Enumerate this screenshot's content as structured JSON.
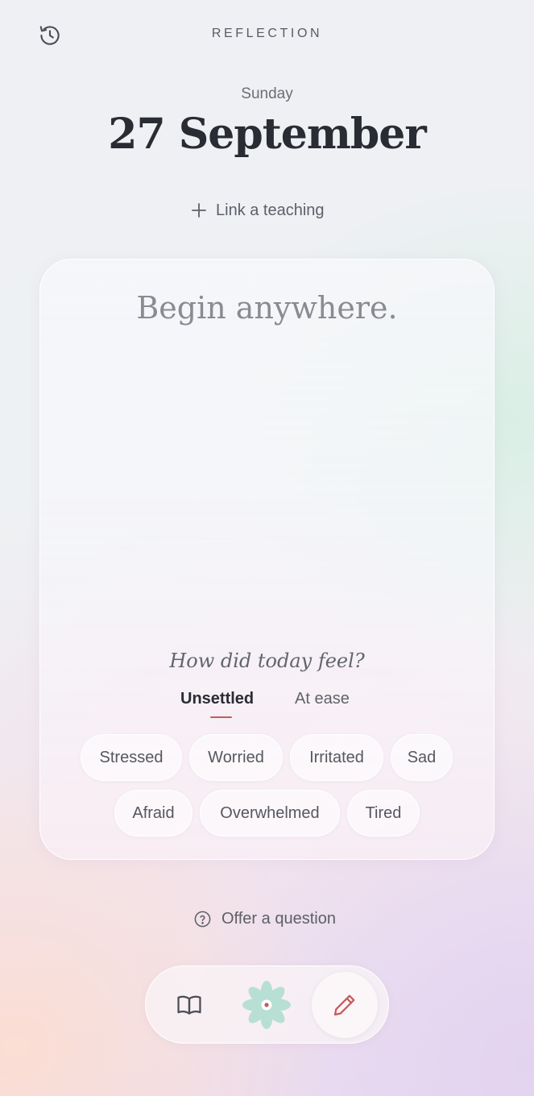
{
  "header": {
    "title": "REFLECTION",
    "history_icon": "history-icon"
  },
  "date": {
    "weekday": "Sunday",
    "full": "27 September"
  },
  "link_teaching": {
    "icon": "plus-icon",
    "label": "Link a teaching"
  },
  "editor": {
    "placeholder": "Begin anywhere."
  },
  "mood": {
    "question": "How did today feel?",
    "tabs": [
      {
        "label": "Unsettled",
        "selected": true
      },
      {
        "label": "At ease",
        "selected": false
      }
    ],
    "chips": [
      "Stressed",
      "Worried",
      "Irritated",
      "Sad",
      "Afraid",
      "Overwhelmed",
      "Tired"
    ]
  },
  "offer_question": {
    "icon": "help-circle-icon",
    "label": "Offer a question"
  },
  "bottom_nav": {
    "items": [
      {
        "icon": "book-icon",
        "active": false
      },
      {
        "icon": "lotus-icon",
        "active": false
      },
      {
        "icon": "pencil-icon",
        "active": true
      }
    ]
  },
  "colors": {
    "accent": "#c75a5a",
    "lotus": "#a9dccb",
    "text_primary": "#2a2c33",
    "text_secondary": "#5d6068"
  }
}
